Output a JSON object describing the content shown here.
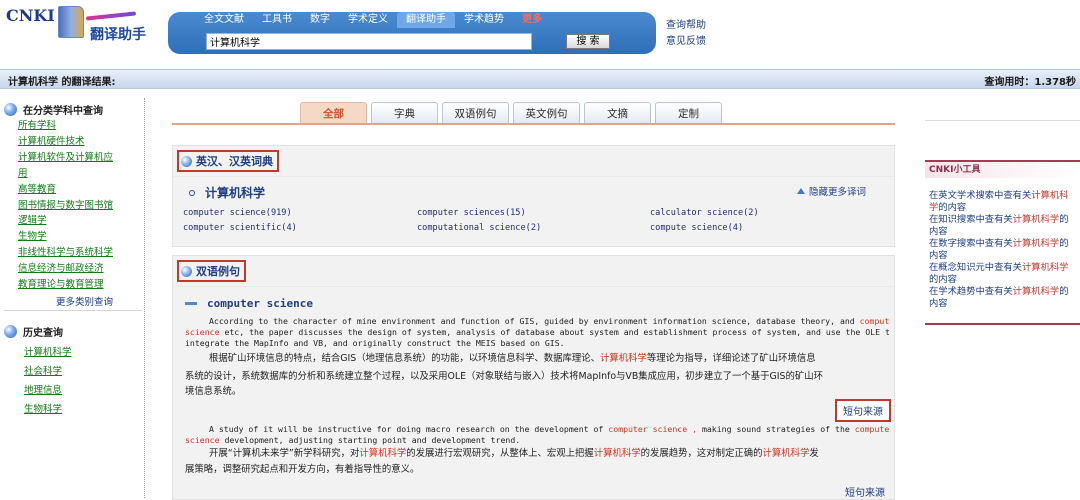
{
  "logo": {
    "brand": "CNKI",
    "product": "翻译助手"
  },
  "nav": {
    "tabs": [
      "全文文献",
      "工具书",
      "数字",
      "学术定义",
      "翻译助手",
      "学术趋势",
      "更多"
    ],
    "active_index": 4
  },
  "search": {
    "value": "计算机科学",
    "button_label": "搜 索"
  },
  "header_links": {
    "help": "查询帮助",
    "feedback": "意见反馈"
  },
  "result_bar": {
    "title": "计算机科学 的翻译结果:",
    "query_time": "查询用时：1.378秒"
  },
  "sidebar": {
    "category_heading": "在分类学科中查询",
    "categories": [
      "所有学科",
      "计算机硬件技术",
      "计算机软件及计算机应",
      "用",
      "高等教育",
      "图书情报与数字图书馆",
      "逻辑学",
      "生物学",
      "非线性科学与系统科学",
      "信息经济与邮政经济",
      "教育理论与教育管理"
    ],
    "more_categories": "更多类别查询",
    "history_heading": "历史查询",
    "history": [
      "计算机科学",
      "社会科学",
      "地理信息",
      "生物科学"
    ]
  },
  "content_tabs": {
    "items": [
      "全部",
      "字典",
      "双语例句",
      "英文例句",
      "文摘",
      "定制"
    ],
    "active_index": 0
  },
  "dictionary": {
    "title": "英汉、汉英词典",
    "term": "计算机科学",
    "hide_more": "隐藏更多译词",
    "translations": [
      "computer science(919)",
      "computer sciences(15)",
      "calculator science(2)",
      "computer scientific(4)",
      "computational science(2)",
      "compute science(4)"
    ]
  },
  "bilingual": {
    "title": "双语例句",
    "term": "computer science",
    "example1": {
      "en_l1_a": "According to the character of mine environment and function of GIS, guided by environment information science, database theory, and ",
      "en_l1_hl": "computer",
      "en_l2_hl": "science",
      "en_l2_b": " etc, the paper discusses the design of system, analysis of database about system and establishment process of system, and use the OLE to",
      "en_l3": "integrate the MapInfo and VB, and originally construct the MEIS based on GIS.",
      "zh_l1_a": "根据矿山环境信息的特点，结合GIS（地理信息系统）的功能，以环境信息科学、数据库理论、",
      "zh_l1_hl": "计算机科学",
      "zh_l1_b": "等理论为指导，详细论述了矿山环境信息",
      "zh_l2": "系统的设计，系统数据库的分析和系统建立整个过程，以及采用OLE（对象联结与嵌入）技术将MapInfo与VB集成应用，初步建立了一个基于GIS的矿山环",
      "zh_l3": "境信息系统。",
      "source": "短句来源"
    },
    "example2": {
      "en_l1_a": "A study of it will be instructive for doing macro research on the development of ",
      "en_l1_hl1": "computer science ,",
      "en_l1_b": " making sound strategies of the ",
      "en_l1_hl2": "computer",
      "en_l2_hl": "science",
      "en_l2_b": " development, adjusting starting point and development trend.",
      "zh_l1_a": "开展“计算机未来学”新学科研究，对",
      "zh_l1_hl1": "计算机科学",
      "zh_l1_b": "的发展进行宏观研究，从整体上、宏观上把握",
      "zh_l1_hl2": "计算机科学",
      "zh_l1_c": "的发展趋势，这对制定正确的",
      "zh_l1_hl3": "计算机科学",
      "zh_l1_d": "发",
      "zh_l2": "展策略，调整研究起点和开发方向，有着指导性的意义。",
      "source": "短句来源"
    }
  },
  "tools": {
    "title": "CNKI小工具",
    "items": [
      {
        "a": "在英文学术搜索中查有关",
        "hl": "计算机科",
        "b": "学",
        "c": "的内容"
      },
      {
        "a": "在知识搜索中查有关",
        "hl": "计算机科学",
        "b": "的",
        "c": "内容"
      },
      {
        "a": "在数字搜索中查有关",
        "hl": "计算机科学",
        "b": "的",
        "c": "内容"
      },
      {
        "a": "在概念知识元中查有关",
        "hl": "计算机科学",
        "b": "",
        "c": "的内容"
      },
      {
        "a": "在学术趋势中查有关",
        "hl": "计算机科学",
        "b": "的",
        "c": "内容"
      }
    ]
  },
  "colors": {
    "header_blue": "#2f6eb8",
    "highlight_red": "#d0341f",
    "box_red": "#c0392b",
    "link_blue": "#1f3f83",
    "category_green": "#137a16"
  }
}
